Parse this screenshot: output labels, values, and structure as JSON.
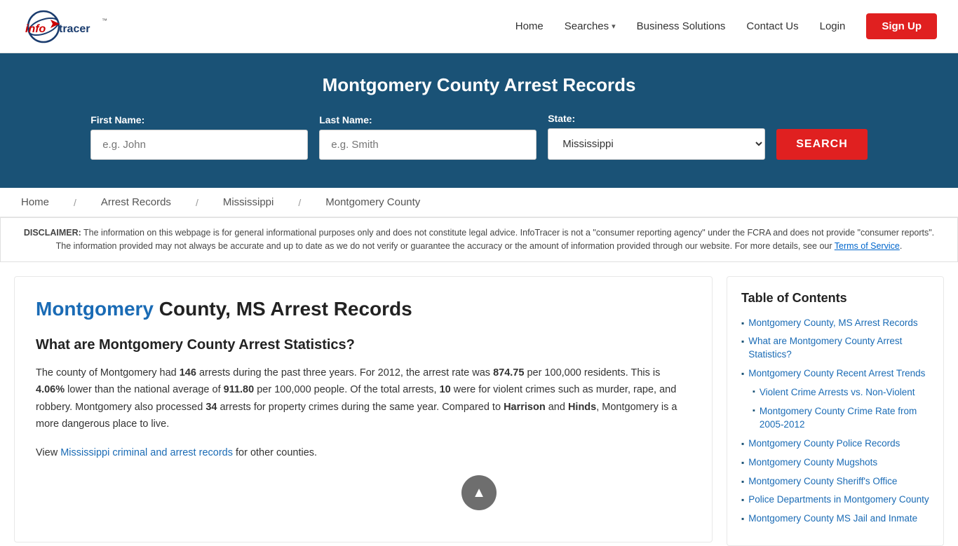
{
  "header": {
    "logo_text_info": "info",
    "logo_text_tracer": "tracer",
    "nav": {
      "home": "Home",
      "searches": "Searches",
      "business_solutions": "Business Solutions",
      "contact_us": "Contact Us",
      "login": "Login",
      "signup": "Sign Up"
    }
  },
  "hero": {
    "title": "Montgomery County Arrest Records",
    "form": {
      "first_name_label": "First Name:",
      "first_name_placeholder": "e.g. John",
      "last_name_label": "Last Name:",
      "last_name_placeholder": "e.g. Smith",
      "state_label": "State:",
      "state_value": "Mississippi",
      "search_button": "SEARCH"
    }
  },
  "breadcrumb": {
    "home": "Home",
    "arrest_records": "Arrest Records",
    "mississippi": "Mississippi",
    "montgomery_county": "Montgomery County"
  },
  "disclaimer": {
    "prefix": "DISCLAIMER:",
    "text": " The information on this webpage is for general informational purposes only and does not constitute legal advice. InfoTracer is not a \"consumer reporting agency\" under the FCRA and does not provide \"consumer reports\". The information provided may not always be accurate and up to date as we do not verify or guarantee the accuracy or the amount of information provided through our website. For more details, see our ",
    "tos_link": "Terms of Service",
    "suffix": "."
  },
  "content": {
    "title_highlight": "Montgomery",
    "title_rest": " County, MS Arrest Records",
    "section1_heading": "What are Montgomery County Arrest Statistics?",
    "section1_p1_part1": "The county of Montgomery had ",
    "section1_p1_arrests": "146",
    "section1_p1_part2": " arrests during the past three years. For 2012, the arrest rate was ",
    "section1_p1_rate": "874.75",
    "section1_p1_part3": " per 100,000 residents. This is ",
    "section1_p1_lower": "4.06%",
    "section1_p1_part4": " lower than the national average of ",
    "section1_p1_national": "911.80",
    "section1_p1_part5": " per 100,000 people. Of the total arrests, ",
    "section1_p1_violent": "10",
    "section1_p1_part6": " were for violent crimes such as murder, rape, and robbery. Montgomery also processed ",
    "section1_p1_property": "34",
    "section1_p1_part7": " arrests for property crimes during the same year. Compared to ",
    "section1_p1_county1": "Harrison",
    "section1_p1_part8": " and ",
    "section1_p1_county2": "Hinds",
    "section1_p1_part9": ", Montgomery is a more dangerous place to live.",
    "section1_p2_prefix": "View ",
    "section1_p2_link": "Mississippi criminal and arrest records",
    "section1_p2_suffix": " for other counties."
  },
  "toc": {
    "heading": "Table of Contents",
    "items": [
      {
        "label": "Montgomery County, MS Arrest Records",
        "sub": false
      },
      {
        "label": "What are Montgomery County Arrest Statistics?",
        "sub": false
      },
      {
        "label": "Montgomery County Recent Arrest Trends",
        "sub": false
      },
      {
        "label": "Violent Crime Arrests vs. Non-Violent",
        "sub": true
      },
      {
        "label": "Montgomery County Crime Rate from 2005-2012",
        "sub": true
      },
      {
        "label": "Montgomery County Police Records",
        "sub": false
      },
      {
        "label": "Montgomery County Mugshots",
        "sub": false
      },
      {
        "label": "Montgomery County Sheriff's Office",
        "sub": false
      },
      {
        "label": "Police Departments in Montgomery County",
        "sub": false
      },
      {
        "label": "Montgomery County MS Jail and Inmate",
        "sub": false
      }
    ]
  },
  "scroll_top_label": "▲"
}
